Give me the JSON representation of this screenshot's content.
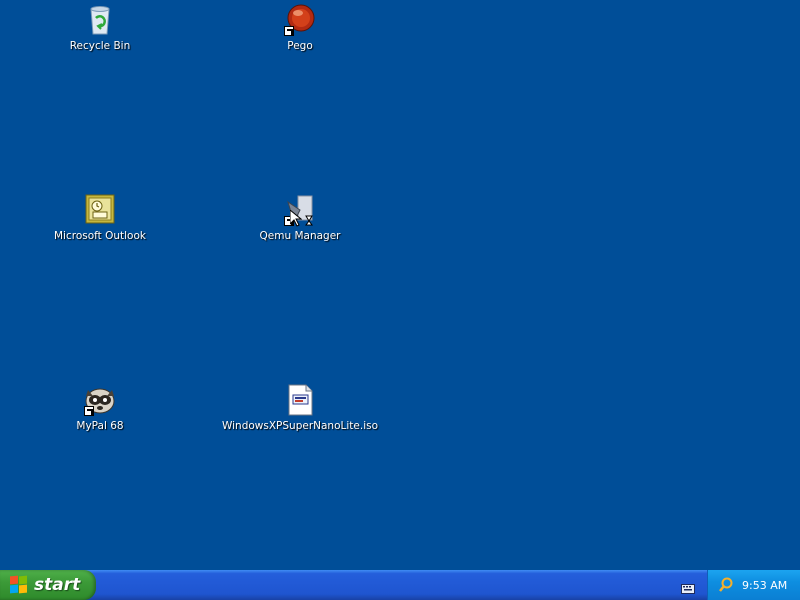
{
  "desktop": {
    "icons": [
      {
        "label": "Recycle Bin",
        "icon": "recycle-bin-icon"
      },
      {
        "label": "Pego",
        "icon": "pego-icon"
      },
      {
        "label": "Microsoft Outlook",
        "icon": "outlook-icon"
      },
      {
        "label": "Qemu Manager",
        "icon": "qemu-manager-icon"
      },
      {
        "label": "MyPal 68",
        "icon": "mypal-icon"
      },
      {
        "label": "WindowsXPSuperNanoLite.iso",
        "icon": "iso-file-icon"
      }
    ]
  },
  "taskbar": {
    "start_label": "start",
    "clock": "9:53 AM"
  },
  "colors": {
    "desktop_bg": "#004e98",
    "taskbar_blue": "#245edb",
    "start_green": "#3c9a38",
    "tray_blue": "#0e8ee0"
  }
}
